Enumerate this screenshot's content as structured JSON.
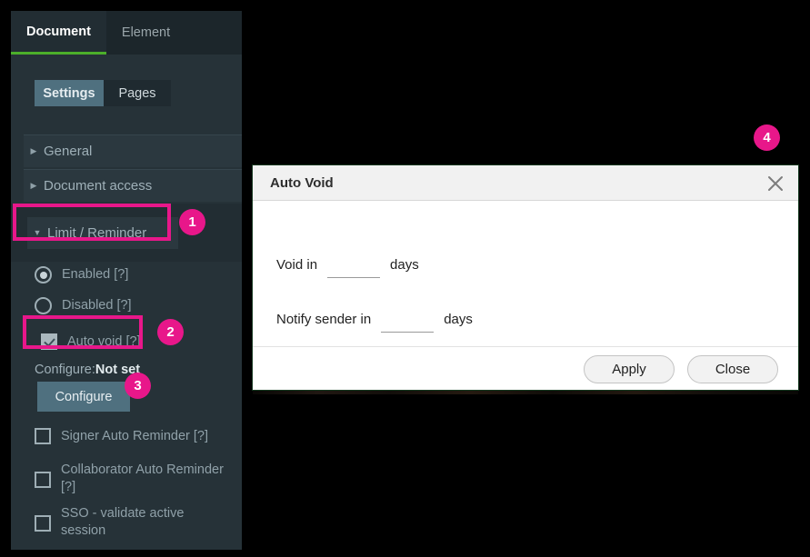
{
  "top_tabs": [
    {
      "label": "Document",
      "active": true
    },
    {
      "label": "Element",
      "active": false
    }
  ],
  "sub_tabs": [
    {
      "label": "Settings",
      "active": true
    },
    {
      "label": "Pages",
      "active": false
    }
  ],
  "accordions": [
    {
      "label": "General",
      "caret": "▶",
      "expanded": false
    },
    {
      "label": "Document access",
      "caret": "▶",
      "expanded": false
    },
    {
      "label": "Limit / Reminder",
      "caret": "▼",
      "expanded": true
    }
  ],
  "options": [
    {
      "label": "Enabled [?]",
      "type": "radio",
      "checked": true
    },
    {
      "label": "Disabled [?]",
      "type": "radio",
      "checked": false
    },
    {
      "label": "Auto void [?]",
      "type": "checkbox",
      "checked": true
    },
    {
      "label": "Signer Auto Reminder [?]",
      "type": "checkbox",
      "checked": false
    },
    {
      "label": "Collaborator Auto Reminder [?]",
      "type": "checkbox",
      "checked": false
    },
    {
      "label": "SSO - validate active session",
      "type": "checkbox",
      "checked": false
    }
  ],
  "configure": {
    "status_prefix": "Configure:",
    "status_value": "Not set",
    "button_label": "Configure"
  },
  "annotations": {
    "badge_1": "1",
    "badge_2": "2",
    "badge_3": "3",
    "badge_4": "4",
    "color": "#e8178a"
  },
  "modal": {
    "title": "Auto Void",
    "close_icon": "close-icon",
    "fields": [
      {
        "label": "Void in",
        "value": "",
        "placeholder": "",
        "unit": "days"
      },
      {
        "label": "Notify sender in",
        "value": "",
        "placeholder": "",
        "unit": "days"
      }
    ],
    "buttons": [
      {
        "label": "Apply"
      },
      {
        "label": "Close"
      }
    ]
  },
  "theme": {
    "panel_bg": "#263238",
    "tab_accent": "#4caf2a",
    "subtab_active_bg": "#4f707f",
    "modal_border": "#14381f"
  }
}
